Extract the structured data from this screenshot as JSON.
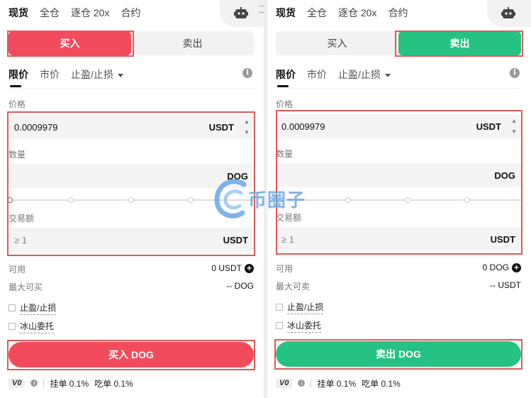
{
  "top_tabs": [
    "现货",
    "全仓",
    "逐仓 20x",
    "合约"
  ],
  "order_tabs": {
    "limit": "限价",
    "market": "市价",
    "tpsl": "止盈/止损"
  },
  "labels": {
    "price": "价格",
    "amount": "数量",
    "total": "交易额",
    "available": "可用"
  },
  "checkboxes": {
    "tpsl": "止盈/止损",
    "iceberg": "冰山委托"
  },
  "fees": {
    "vip": "V0",
    "maker": "挂单 0.1%",
    "taker": "吃单 0.1%"
  },
  "stepper": {
    "up": "▲",
    "down": "▼"
  },
  "buy_panel": {
    "segment": {
      "buy": "买入",
      "sell": "卖出"
    },
    "price_value": "0.0009979",
    "price_unit": "USDT",
    "amount_unit": "DOG",
    "total_placeholder": "≥ 1",
    "total_unit": "USDT",
    "available_value": "0 USDT",
    "max_label": "最大可买",
    "max_value": "-- DOG",
    "action": "买入 DOG"
  },
  "sell_panel": {
    "segment": {
      "buy": "买入",
      "sell": "卖出"
    },
    "price_value": "0.0009979",
    "price_unit": "USDT",
    "amount_unit": "DOG",
    "total_placeholder": "≥ 1",
    "total_unit": "USDT",
    "available_value": "0 DOG",
    "max_label": "最大可卖",
    "max_value": "-- USDT",
    "action": "卖出 DOG"
  },
  "watermark": {
    "text": "币圈子",
    "color": "#6aa8e8"
  },
  "colors": {
    "buy": "#f24c5c",
    "sell": "#26c281",
    "highlight": "#e05a5a"
  },
  "icons": [
    "robot-icon",
    "info-icon",
    "plus-icon",
    "chevron-down-icon"
  ]
}
